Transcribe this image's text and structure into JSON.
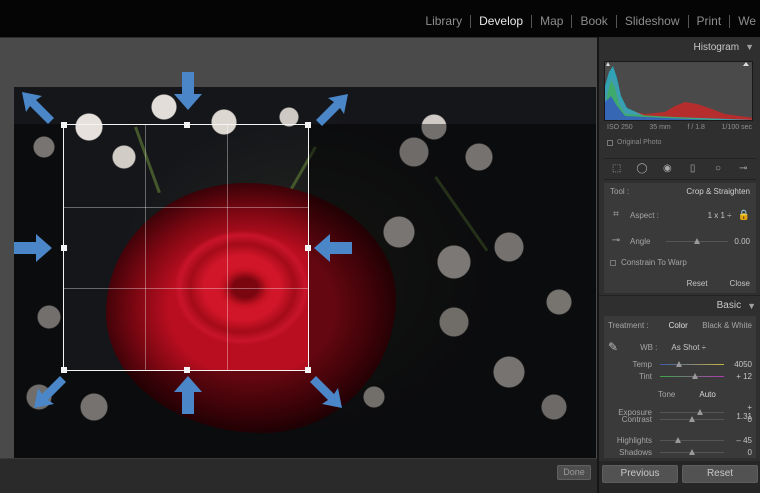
{
  "top_nav": {
    "modules": [
      "Library",
      "Develop",
      "Map",
      "Book",
      "Slideshow",
      "Print",
      "We"
    ],
    "active": "Develop"
  },
  "canvas": {
    "done_label": "Done"
  },
  "histogram": {
    "title": "Histogram",
    "iso": "ISO 250",
    "focal": "35 mm",
    "aperture": "f / 1.8",
    "shutter": "1/100 sec",
    "original_photo": "Original Photo"
  },
  "crop": {
    "tool_label": "Tool :",
    "tool_name": "Crop & Straighten",
    "aspect_label": "Aspect :",
    "aspect_value": "1 x 1 ÷",
    "angle_label": "Angle",
    "angle_value": "0.00",
    "angle_level": 0.5,
    "constrain_label": "Constrain To Warp",
    "reset_label": "Reset",
    "close_label": "Close"
  },
  "basic": {
    "title": "Basic",
    "treatment_label": "Treatment :",
    "color_label": "Color",
    "bw_label": "Black & White",
    "wb_label": "WB :",
    "wb_value": "As Shot ÷",
    "temp_label": "Temp",
    "temp_value": "4050",
    "temp_level": 0.3,
    "tint_label": "Tint",
    "tint_value": "+ 12",
    "tint_level": 0.55,
    "tone_label": "Tone",
    "auto_label": "Auto",
    "exposure_label": "Exposure",
    "exposure_value": "+ 1.31",
    "exposure_level": 0.62,
    "contrast_label": "Contrast",
    "contrast_value": "0",
    "contrast_level": 0.5,
    "highlights_label": "Highlights",
    "highlights_value": "– 45",
    "highlights_level": 0.28,
    "shadows_label": "Shadows",
    "shadows_value": "0",
    "shadows_level": 0.5
  },
  "footer": {
    "previous_label": "Previous",
    "reset_label": "Reset"
  },
  "colors": {
    "rose": "#c41222",
    "background": "#4a4a4a",
    "arrow": "#4a86c8"
  }
}
